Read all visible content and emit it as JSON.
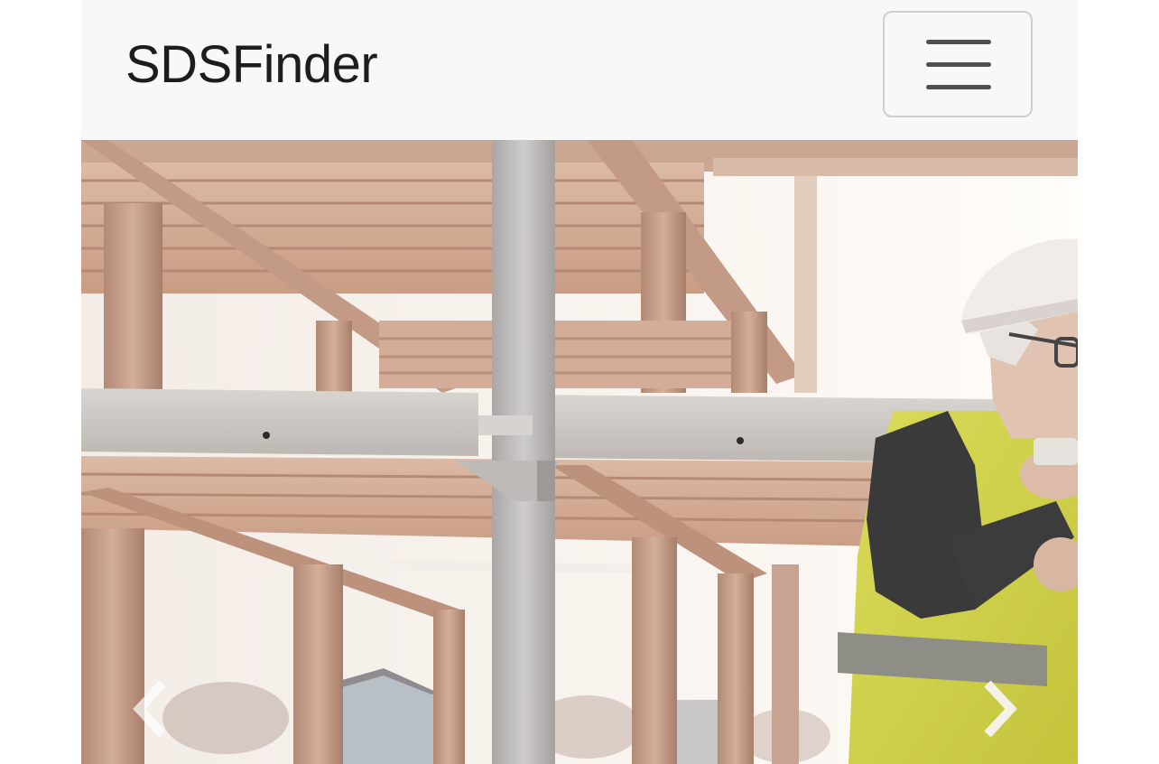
{
  "navbar": {
    "brand": "SDSFinder",
    "toggler_icon": "hamburger-menu-icon"
  },
  "carousel": {
    "prev_icon": "chevron-left-icon",
    "next_icon": "chevron-right-icon"
  },
  "colors": {
    "navbar_bg": "#f8f8f8",
    "brand_text": "#1d1d1d",
    "toggler_border": "#cfcfcf",
    "toggler_bars": "#4f4f4f"
  }
}
